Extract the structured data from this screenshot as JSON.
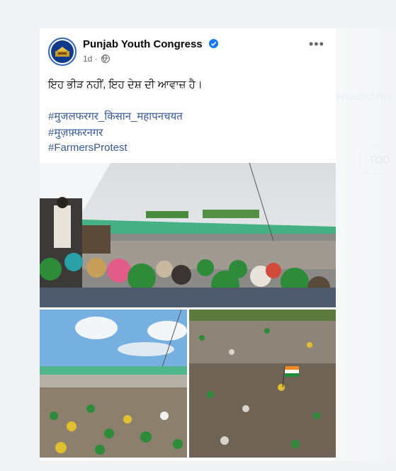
{
  "post": {
    "page_name": "Punjab Youth Congress",
    "time": "1d",
    "separator": "·",
    "text": "ਇਹ ਭੀੜ ਨਹੀਂ, ਇਹ ਦੇਸ਼ ਦੀ ਆਵਾਜ਼ ਹੈ।",
    "hashtags": [
      "#मुजलफरगर_किसान_महापनचयत",
      "#मुज़फ़्फरनगर",
      "#FarmersProtest"
    ],
    "more_label": "•••"
  },
  "icons": {
    "verified": "verified-badge-icon",
    "globe": "globe-icon",
    "more": "more-options-icon"
  },
  "colors": {
    "link": "#385898",
    "verified": "#1877f2",
    "avatar_ring": "#2e64b5",
    "crowd_green": "#2e8b3a"
  },
  "background": {
    "ghost_text": "swachchhta",
    "ghost_pill": "TOD"
  }
}
